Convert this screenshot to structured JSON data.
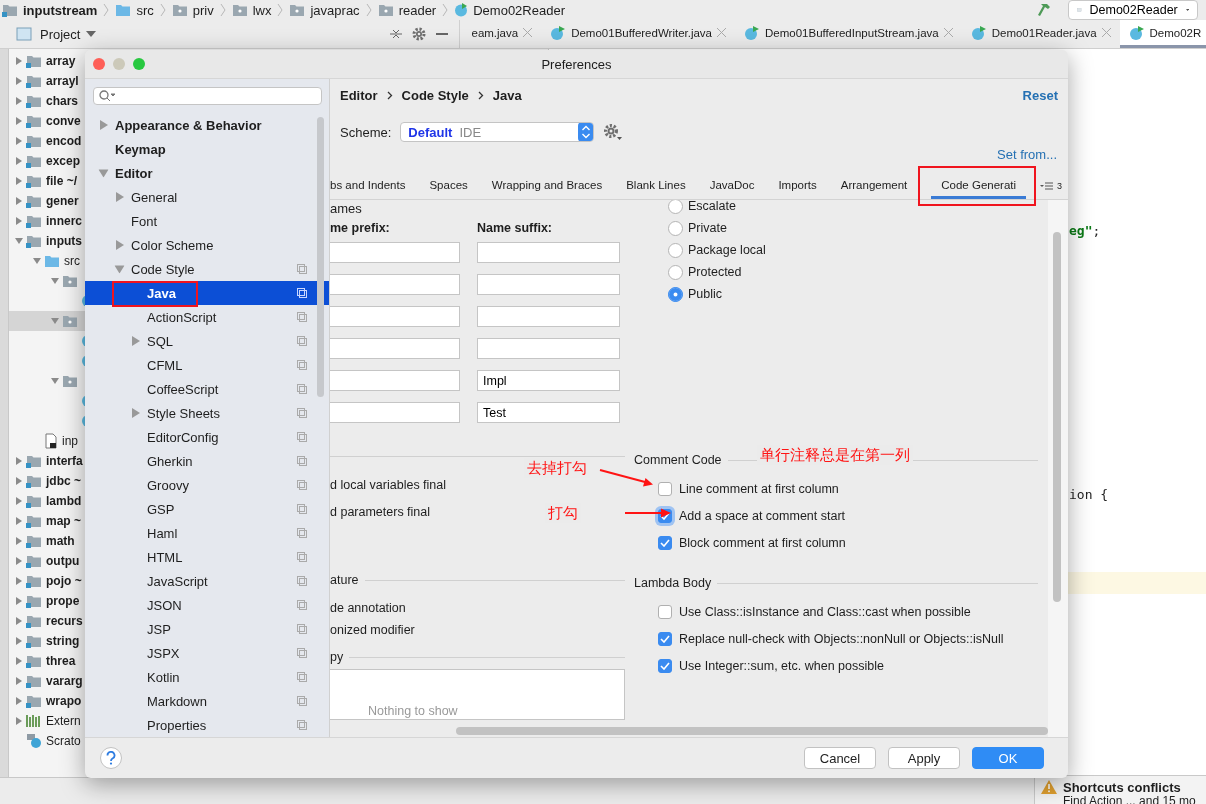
{
  "breadcrumb": [
    {
      "label": "inputstream",
      "kind": "module"
    },
    {
      "label": "src",
      "kind": "source"
    },
    {
      "label": "priv",
      "kind": "package"
    },
    {
      "label": "lwx",
      "kind": "package"
    },
    {
      "label": "javaprac",
      "kind": "package"
    },
    {
      "label": "reader",
      "kind": "package"
    },
    {
      "label": "Demo02Reader",
      "kind": "class"
    }
  ],
  "run_config": "Demo02Reader",
  "project_panel": {
    "title": "Project",
    "tree": [
      {
        "label": "array",
        "kind": "module",
        "expanded": false,
        "selected": false
      },
      {
        "label": "arrayl",
        "kind": "module",
        "expanded": false,
        "selected": false
      },
      {
        "label": "chars",
        "kind": "module",
        "expanded": false,
        "selected": false
      },
      {
        "label": "conve",
        "kind": "module",
        "expanded": false,
        "selected": false
      },
      {
        "label": "encod",
        "kind": "module",
        "expanded": false,
        "selected": false
      },
      {
        "label": "excep",
        "kind": "module",
        "expanded": false,
        "selected": false
      },
      {
        "label": "file ~/",
        "kind": "module",
        "expanded": false,
        "selected": false
      },
      {
        "label": "gener",
        "kind": "module",
        "expanded": false,
        "selected": false
      },
      {
        "label": "innerc",
        "kind": "module",
        "expanded": false,
        "selected": false
      },
      {
        "label": "inputs",
        "kind": "module",
        "expanded": true,
        "selected": false,
        "children": [
          {
            "label": "src",
            "kind": "source",
            "expanded": true,
            "selected": false,
            "children": [
              {
                "kind": "package",
                "expanded": true,
                "selected": false,
                "children": [
                  {
                    "kind": "class",
                    "selected": false
                  }
                ]
              },
              {
                "kind": "package",
                "expanded": true,
                "selected": true,
                "children": [
                  {
                    "kind": "class",
                    "selected": false
                  },
                  {
                    "kind": "class",
                    "selected": false
                  }
                ]
              },
              {
                "kind": "package",
                "expanded": true,
                "selected": false,
                "children": [
                  {
                    "kind": "class",
                    "selected": false
                  },
                  {
                    "kind": "class",
                    "selected": false
                  }
                ]
              }
            ]
          },
          {
            "label": "inp",
            "kind": "file",
            "selected": false
          }
        ]
      },
      {
        "label": "interfa",
        "kind": "module",
        "expanded": false,
        "selected": false
      },
      {
        "label": "jdbc ~",
        "kind": "module",
        "expanded": false,
        "selected": false
      },
      {
        "label": "lambd",
        "kind": "module",
        "expanded": false,
        "selected": false
      },
      {
        "label": "map ~",
        "kind": "module",
        "expanded": false,
        "selected": false
      },
      {
        "label": "math",
        "kind": "module",
        "expanded": false,
        "selected": false
      },
      {
        "label": "outpu",
        "kind": "module",
        "expanded": false,
        "selected": false
      },
      {
        "label": "pojo ~",
        "kind": "module",
        "expanded": false,
        "selected": false
      },
      {
        "label": "prope",
        "kind": "module",
        "expanded": false,
        "selected": false
      },
      {
        "label": "recurs",
        "kind": "module",
        "expanded": false,
        "selected": false
      },
      {
        "label": "string",
        "kind": "module",
        "expanded": false,
        "selected": false
      },
      {
        "label": "threa",
        "kind": "module",
        "expanded": false,
        "selected": false
      },
      {
        "label": "vararg",
        "kind": "module",
        "expanded": false,
        "selected": false
      },
      {
        "label": "wrapo",
        "kind": "module",
        "expanded": false,
        "selected": false
      },
      {
        "label": "Extern",
        "kind": "library",
        "expanded": false,
        "selected": false
      },
      {
        "label": "Scrato",
        "kind": "scratch",
        "selected": false
      }
    ]
  },
  "editor_tabs": [
    {
      "label": "eam.java",
      "selected": false,
      "icon": false,
      "closable": true
    },
    {
      "label": "Demo01BufferedWriter.java",
      "selected": false,
      "icon": true,
      "closable": true
    },
    {
      "label": "Demo01BufferedInputStream.java",
      "selected": false,
      "icon": true,
      "closable": true
    },
    {
      "label": "Demo01Reader.java",
      "selected": false,
      "icon": true,
      "closable": true
    },
    {
      "label": "Demo02R",
      "selected": true,
      "icon": true,
      "closable": false
    }
  ],
  "editor": {
    "lines": [
      {
        "current": false,
        "segments": [
          {
            "text": "eg\"",
            "kind": "string"
          },
          {
            "text": ";",
            "kind": "plain"
          }
        ]
      },
      {
        "current": false,
        "segments": [
          {
            "text": "ion {",
            "kind": "plain"
          }
        ]
      },
      {
        "current": true
      }
    ]
  },
  "notification": {
    "title": "Shortcuts conflicts",
    "text": "Find Action ... and 15 mo"
  },
  "dialog": {
    "title": "Preferences",
    "tree": [
      {
        "label": "Appearance & Behavior",
        "expanded": false,
        "selected": false,
        "scoped": false
      },
      {
        "label": "Keymap",
        "selected": false,
        "scoped": false
      },
      {
        "label": "Editor",
        "expanded": true,
        "selected": false,
        "scoped": false,
        "children": [
          {
            "label": "General",
            "expanded": false,
            "selected": false,
            "scoped": false
          },
          {
            "label": "Font",
            "selected": false,
            "scoped": false
          },
          {
            "label": "Color Scheme",
            "expanded": false,
            "selected": false,
            "scoped": false
          },
          {
            "label": "Code Style",
            "expanded": true,
            "selected": false,
            "scoped": true,
            "children": [
              {
                "label": "Java",
                "selected": true,
                "scoped": true
              },
              {
                "label": "ActionScript",
                "selected": false,
                "scoped": true
              },
              {
                "label": "SQL",
                "expanded": false,
                "selected": false,
                "scoped": true
              },
              {
                "label": "CFML",
                "selected": false,
                "scoped": true
              },
              {
                "label": "CoffeeScript",
                "selected": false,
                "scoped": true
              },
              {
                "label": "Style Sheets",
                "expanded": false,
                "selected": false,
                "scoped": true
              },
              {
                "label": "EditorConfig",
                "selected": false,
                "scoped": true
              },
              {
                "label": "Gherkin",
                "selected": false,
                "scoped": true
              },
              {
                "label": "Groovy",
                "selected": false,
                "scoped": true
              },
              {
                "label": "GSP",
                "selected": false,
                "scoped": true
              },
              {
                "label": "Haml",
                "selected": false,
                "scoped": true
              },
              {
                "label": "HTML",
                "selected": false,
                "scoped": true
              },
              {
                "label": "JavaScript",
                "selected": false,
                "scoped": true
              },
              {
                "label": "JSON",
                "selected": false,
                "scoped": true
              },
              {
                "label": "JSP",
                "selected": false,
                "scoped": true
              },
              {
                "label": "JSPX",
                "selected": false,
                "scoped": true
              },
              {
                "label": "Kotlin",
                "selected": false,
                "scoped": true
              },
              {
                "label": "Markdown",
                "selected": false,
                "scoped": true
              },
              {
                "label": "Properties",
                "selected": false,
                "scoped": true
              }
            ]
          }
        ]
      }
    ],
    "breadcrumb": [
      "Editor",
      "Code Style",
      "Java"
    ],
    "reset": "Reset",
    "scheme": {
      "label": "Scheme:",
      "name": "Default",
      "type": "IDE"
    },
    "set_from": "Set from...",
    "tabs": [
      {
        "label": "bs and Indents",
        "selected": false
      },
      {
        "label": "Spaces",
        "selected": false
      },
      {
        "label": "Wrapping and Braces",
        "selected": false
      },
      {
        "label": "Blank Lines",
        "selected": false
      },
      {
        "label": "JavaDoc",
        "selected": false
      },
      {
        "label": "Imports",
        "selected": false
      },
      {
        "label": "Arrangement",
        "selected": false
      },
      {
        "label": "Code Generati",
        "selected": true
      }
    ],
    "more_tabs": "3",
    "naming": {
      "title": "ames",
      "prefix_label": "me prefix:",
      "suffix_label": "Name suffix:",
      "rows": [
        {
          "kind": "empty"
        },
        {
          "kind": "empty"
        },
        {
          "kind": "empty"
        },
        {
          "kind": "empty"
        },
        {
          "kind": "filled",
          "suffix": "Impl"
        },
        {
          "kind": "filled",
          "suffix": "Test"
        }
      ]
    },
    "final_modifiers": [
      "d local variables final",
      "d parameters final"
    ],
    "signature": {
      "title": "ature",
      "items": [
        "de annotation",
        "onized modifier"
      ]
    },
    "copy": {
      "title": "py",
      "empty_text": "Nothing to show"
    },
    "visibility": [
      {
        "label": "Escalate",
        "selected": false
      },
      {
        "label": "Private",
        "selected": false
      },
      {
        "label": "Package local",
        "selected": false
      },
      {
        "label": "Protected",
        "selected": false
      },
      {
        "label": "Public",
        "selected": true
      }
    ],
    "comment_code": {
      "title": "Comment Code",
      "options": [
        {
          "label": "Line comment at first column",
          "checked": false,
          "focused": false
        },
        {
          "label": "Add a space at comment start",
          "checked": true,
          "focused": true
        },
        {
          "label": "Block comment at first column",
          "checked": true,
          "focused": false
        }
      ]
    },
    "lambda_body": {
      "title": "Lambda Body",
      "options": [
        {
          "label": "Use Class::isInstance and Class::cast when possible",
          "checked": false,
          "focused": false
        },
        {
          "label": "Replace null-check with Objects::nonNull or Objects::isNull",
          "checked": true,
          "focused": false
        },
        {
          "label": "Use Integer::sum, etc. when possible",
          "checked": true,
          "focused": false
        }
      ]
    },
    "buttons": [
      {
        "label": "Cancel",
        "kind": "normal"
      },
      {
        "label": "Apply",
        "kind": "normal"
      },
      {
        "label": "OK",
        "kind": "default"
      }
    ]
  },
  "annotations": [
    {
      "text": "单行注释总是在第一列"
    },
    {
      "text": "去掉打勾"
    },
    {
      "text": "打勾"
    }
  ]
}
